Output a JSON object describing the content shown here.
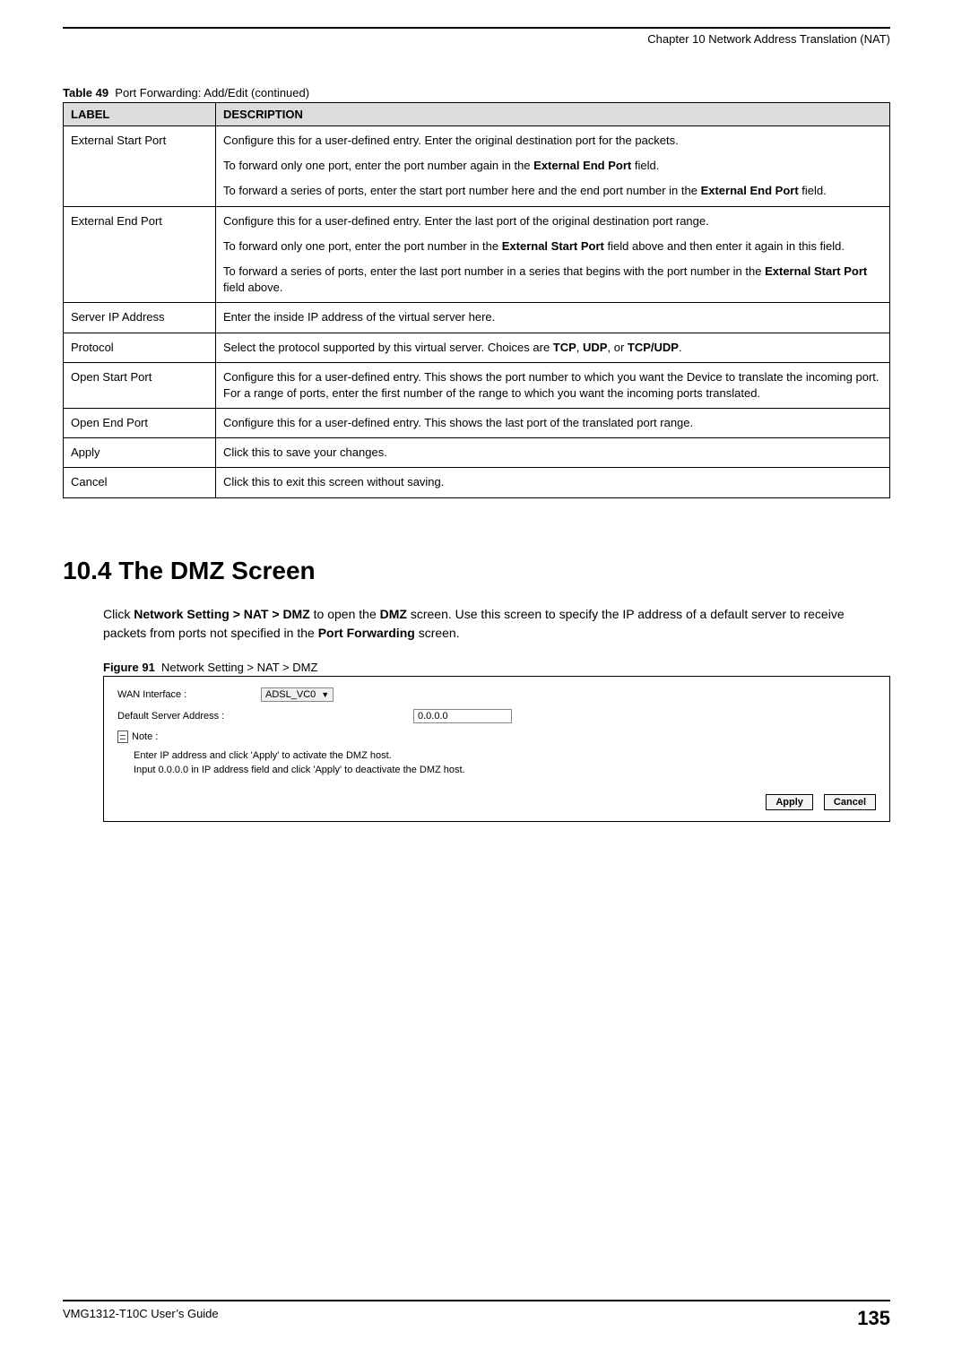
{
  "header": {
    "chapter_title": "Chapter 10 Network Address Translation (NAT)"
  },
  "table": {
    "caption_label": "Table 49",
    "caption_text": "Port Forwarding: Add/Edit (continued)",
    "headers": {
      "label": "LABEL",
      "description": "DESCRIPTION"
    },
    "rows": [
      {
        "label": "External Start Port",
        "paras": [
          "Configure this for a user-defined entry. Enter the original destination port for the packets.",
          "To forward only one port, enter the port number again in the <b>External End Port</b> field.",
          "To forward a series of ports, enter the start port number here and the end port number in the <b>External End Port</b> field."
        ]
      },
      {
        "label": "External End Port",
        "paras": [
          "Configure this for a user-defined entry. Enter the last port of the original destination port range.",
          "To forward only one port, enter the port number in the <b>External Start Port</b> field above and then enter it again in this field.",
          "To forward a series of ports, enter the last port number in a series that begins with the port number in the <b>External Start Port</b> field above."
        ]
      },
      {
        "label": "Server IP Address",
        "paras": [
          "Enter the inside IP address of the virtual server here."
        ]
      },
      {
        "label": "Protocol",
        "paras": [
          "Select the protocol supported by this virtual server. Choices are <b>TCP</b>, <b>UDP</b>, or <b>TCP/UDP</b>."
        ]
      },
      {
        "label": "Open Start Port",
        "paras": [
          "Configure this for a user-defined entry. This shows the port number to which you want the Device to translate the incoming port. For a range of ports, enter the first number of the range to which you want the incoming ports translated."
        ]
      },
      {
        "label": "Open End Port",
        "paras": [
          "Configure this for a user-defined entry. This shows the last port of the translated port range."
        ]
      },
      {
        "label": "Apply",
        "paras": [
          "Click this to save your changes."
        ]
      },
      {
        "label": "Cancel",
        "paras": [
          "Click this to exit this screen without saving."
        ]
      }
    ]
  },
  "section": {
    "heading": "10.4  The DMZ Screen",
    "body_html": "Click <b>Network Setting &gt; NAT &gt; DMZ</b> to open the <b>DMZ</b> screen. Use this screen to specify the IP address of a default server to receive packets from ports not specified in the <b>Port Forwarding</b> screen."
  },
  "figure": {
    "caption_label": "Figure 91",
    "caption_text": "Network Setting > NAT > DMZ",
    "wan_label": "WAN Interface :",
    "wan_value": "ADSL_VC0",
    "default_server_label": "Default Server Address :",
    "default_server_value": "0.0.0.0",
    "note_label": "Note :",
    "note_line1": "Enter IP address and click 'Apply' to activate the DMZ host.",
    "note_line2": "Input 0.0.0.0 in IP address field and click 'Apply' to deactivate the DMZ host.",
    "apply_button": "Apply",
    "cancel_button": "Cancel"
  },
  "footer": {
    "guide": "VMG1312-T10C User’s Guide",
    "page": "135"
  }
}
